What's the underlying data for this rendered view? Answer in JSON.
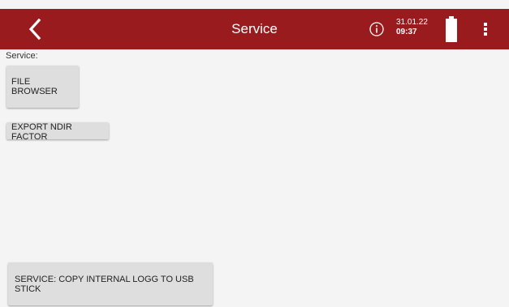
{
  "header": {
    "title": "Service",
    "date": "31.01.22",
    "time": "09:37",
    "icons": [
      "back-arrow-icon",
      "info-icon",
      "battery-icon",
      "more-vert-icon"
    ],
    "bar_color": "#9a1b1e"
  },
  "main": {
    "section_label": "Service:",
    "file_browser_label": "FILE BROWSER",
    "export_ndir_label": "EXPORT NDIR FACTOR",
    "copy_logg_label": "SERVICE: COPY INTERNAL LOGG TO USB STICK"
  }
}
